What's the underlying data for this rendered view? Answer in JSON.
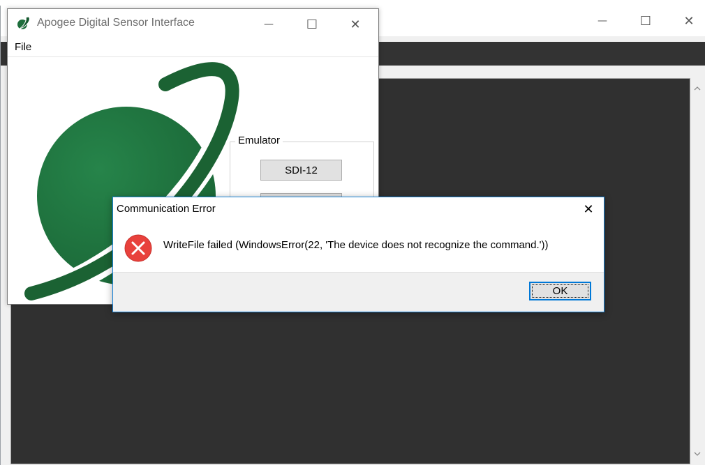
{
  "background_window": {
    "controls": {
      "minimize": "—",
      "maximize": "☐",
      "close": "✕"
    }
  },
  "apogee_window": {
    "title": "Apogee Digital Sensor Interface",
    "controls": {
      "minimize": "—",
      "maximize": "☐",
      "close": "✕"
    },
    "menu": {
      "file": "File"
    },
    "emulator": {
      "legend": "Emulator",
      "buttons": [
        "SDI-12",
        ""
      ]
    },
    "colors": {
      "logo_green": "#1e6e3c",
      "logo_green_dark": "#15582f"
    }
  },
  "error_dialog": {
    "title": "Communication Error",
    "close": "✕",
    "icon": "error-icon",
    "message": "WriteFile failed (WindowsError(22, 'The device does not recognize the command.'))",
    "ok_label": "OK",
    "colors": {
      "error_red": "#e8413c",
      "accent_blue": "#0078d7"
    }
  }
}
